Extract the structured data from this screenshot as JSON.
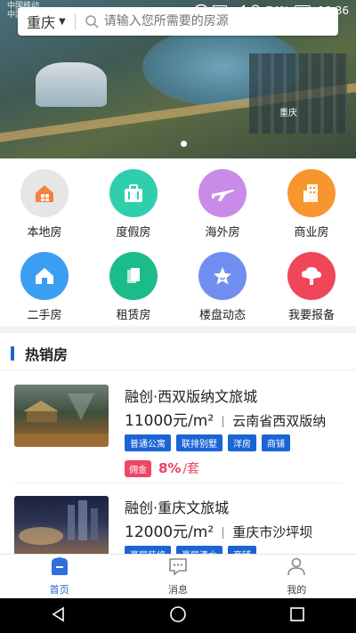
{
  "status_bar": {
    "carrier_1": "中国移动",
    "carrier_2": "中国联通",
    "battery": "74%",
    "time": "10:36"
  },
  "search": {
    "city": "重庆",
    "placeholder": "请输入您所需要的房源"
  },
  "banner": {
    "caption": "重庆",
    "slide_count": 2,
    "active_slide": 1
  },
  "categories": [
    {
      "label": "本地房",
      "icon": "house-icon",
      "color": "#e6e6e6"
    },
    {
      "label": "度假房",
      "icon": "suitcase-icon",
      "color": "#2fcfae"
    },
    {
      "label": "海外房",
      "icon": "airplane-icon",
      "color": "#c98be8"
    },
    {
      "label": "商业房",
      "icon": "building-icon",
      "color": "#f7962f"
    },
    {
      "label": "二手房",
      "icon": "home-icon",
      "color": "#3c9ef2"
    },
    {
      "label": "租赁房",
      "icon": "copy-icon",
      "color": "#1bbc8a"
    },
    {
      "label": "楼盘动态",
      "icon": "star-icon",
      "color": "#6f8ef0"
    },
    {
      "label": "我要报备",
      "icon": "upload-icon",
      "color": "#f0465a"
    }
  ],
  "section": {
    "title": "热销房"
  },
  "listings": [
    {
      "name": "融创·西双版纳文旅城",
      "price": "11000元/m²",
      "location": "云南省西双版纳",
      "tags": [
        "普通公寓",
        "联排别墅",
        "洋房",
        "商铺"
      ],
      "commission_label": "佣金",
      "commission_value": "8%",
      "commission_unit": "/套"
    },
    {
      "name": "融创·重庆文旅城",
      "price": "12000元/m²",
      "location": "重庆市沙坪坝",
      "tags": [
        "豪层装修",
        "豪层清水",
        "商铺"
      ]
    }
  ],
  "tabbar": [
    {
      "label": "首页",
      "icon": "home-tab-icon",
      "active": true
    },
    {
      "label": "消息",
      "icon": "message-icon",
      "active": false
    },
    {
      "label": "我的",
      "icon": "profile-icon",
      "active": false
    }
  ],
  "colors": {
    "accent": "#1b64d6",
    "commission": "#ee3f5f"
  }
}
